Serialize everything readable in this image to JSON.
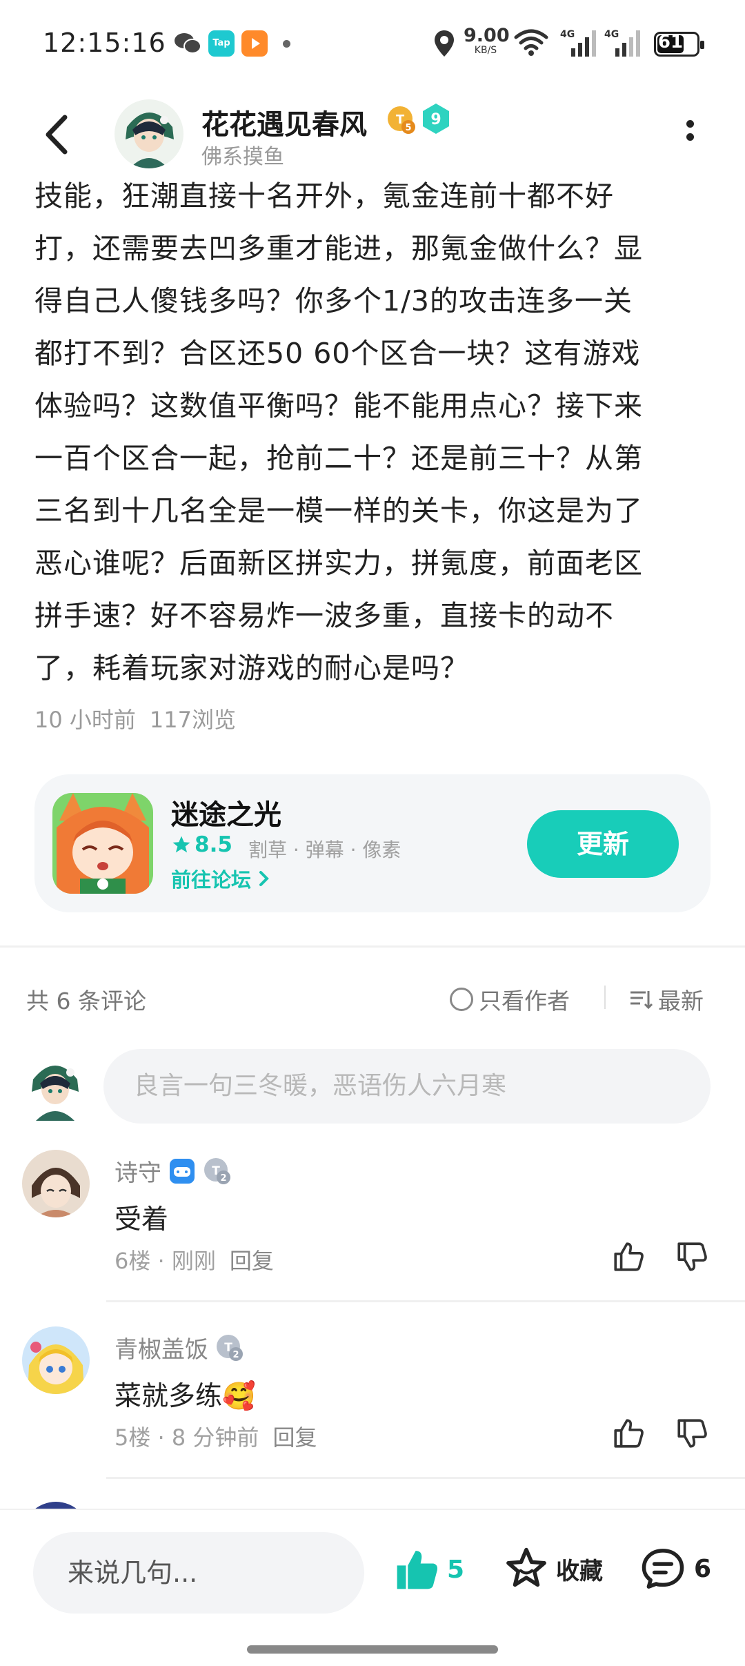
{
  "status_bar": {
    "time": "12:15:16",
    "net_speed_value": "9.00",
    "net_speed_unit": "KB/S",
    "battery": "61",
    "tap_icon_text": "Tap",
    "signal_label_1": "4G",
    "signal_label_2": "4G"
  },
  "header": {
    "author_name": "花花遇见春风",
    "author_subtitle": "佛系摸鱼",
    "badge_level_text": "5",
    "badge_number": "9"
  },
  "article": {
    "lines": [
      "技能，狂潮直接十名开外，氪金连前十都不好",
      "打，还需要去凹多重才能进，那氪金做什么？显",
      "得自己人傻钱多吗？你多个1/3的攻击连多一关",
      "都打不到？合区还50 60个区合一块？这有游戏",
      "体验吗？这数值平衡吗？能不能用点心？接下来",
      "一百个区合一起，抢前二十？还是前三十？从第",
      "三名到十几名全是一模一样的关卡，你这是为了",
      "恶心谁呢？后面新区拼实力，拼氪度，前面老区",
      "拼手速？好不容易炸一波多重，直接卡的动不",
      "了，耗着玩家对游戏的耐心是吗？"
    ],
    "time_ago": "10 小时前",
    "views": "117浏览"
  },
  "game_card": {
    "title": "迷途之光",
    "rating": "8.5",
    "tags": "割草 · 弹幕 · 像素",
    "forum_link": "前往论坛",
    "update_button": "更新"
  },
  "comments_bar": {
    "count_label": "共 6 条评论",
    "only_author": "只看作者",
    "sort": "最新"
  },
  "comment_input": {
    "placeholder": "良言一句三冬暖，恶语伤人六月寒"
  },
  "comments": [
    {
      "name": "诗守",
      "level": "2",
      "text": "受着",
      "floor": "6楼",
      "time": "刚刚",
      "reply": "回复"
    },
    {
      "name": "青椒盖饭",
      "level": "2",
      "text": "菜就多练🥰",
      "floor": "5楼",
      "time": "8 分钟前",
      "reply": "回复"
    }
  ],
  "bottom_bar": {
    "input_placeholder": "来说几句...",
    "like_count": "5",
    "favorite_label": "收藏",
    "comment_count": "6"
  },
  "colors": {
    "accent": "#16c4b0",
    "update_button": "#18cdb9",
    "text": "#222222",
    "muted": "#9a9a9a"
  }
}
